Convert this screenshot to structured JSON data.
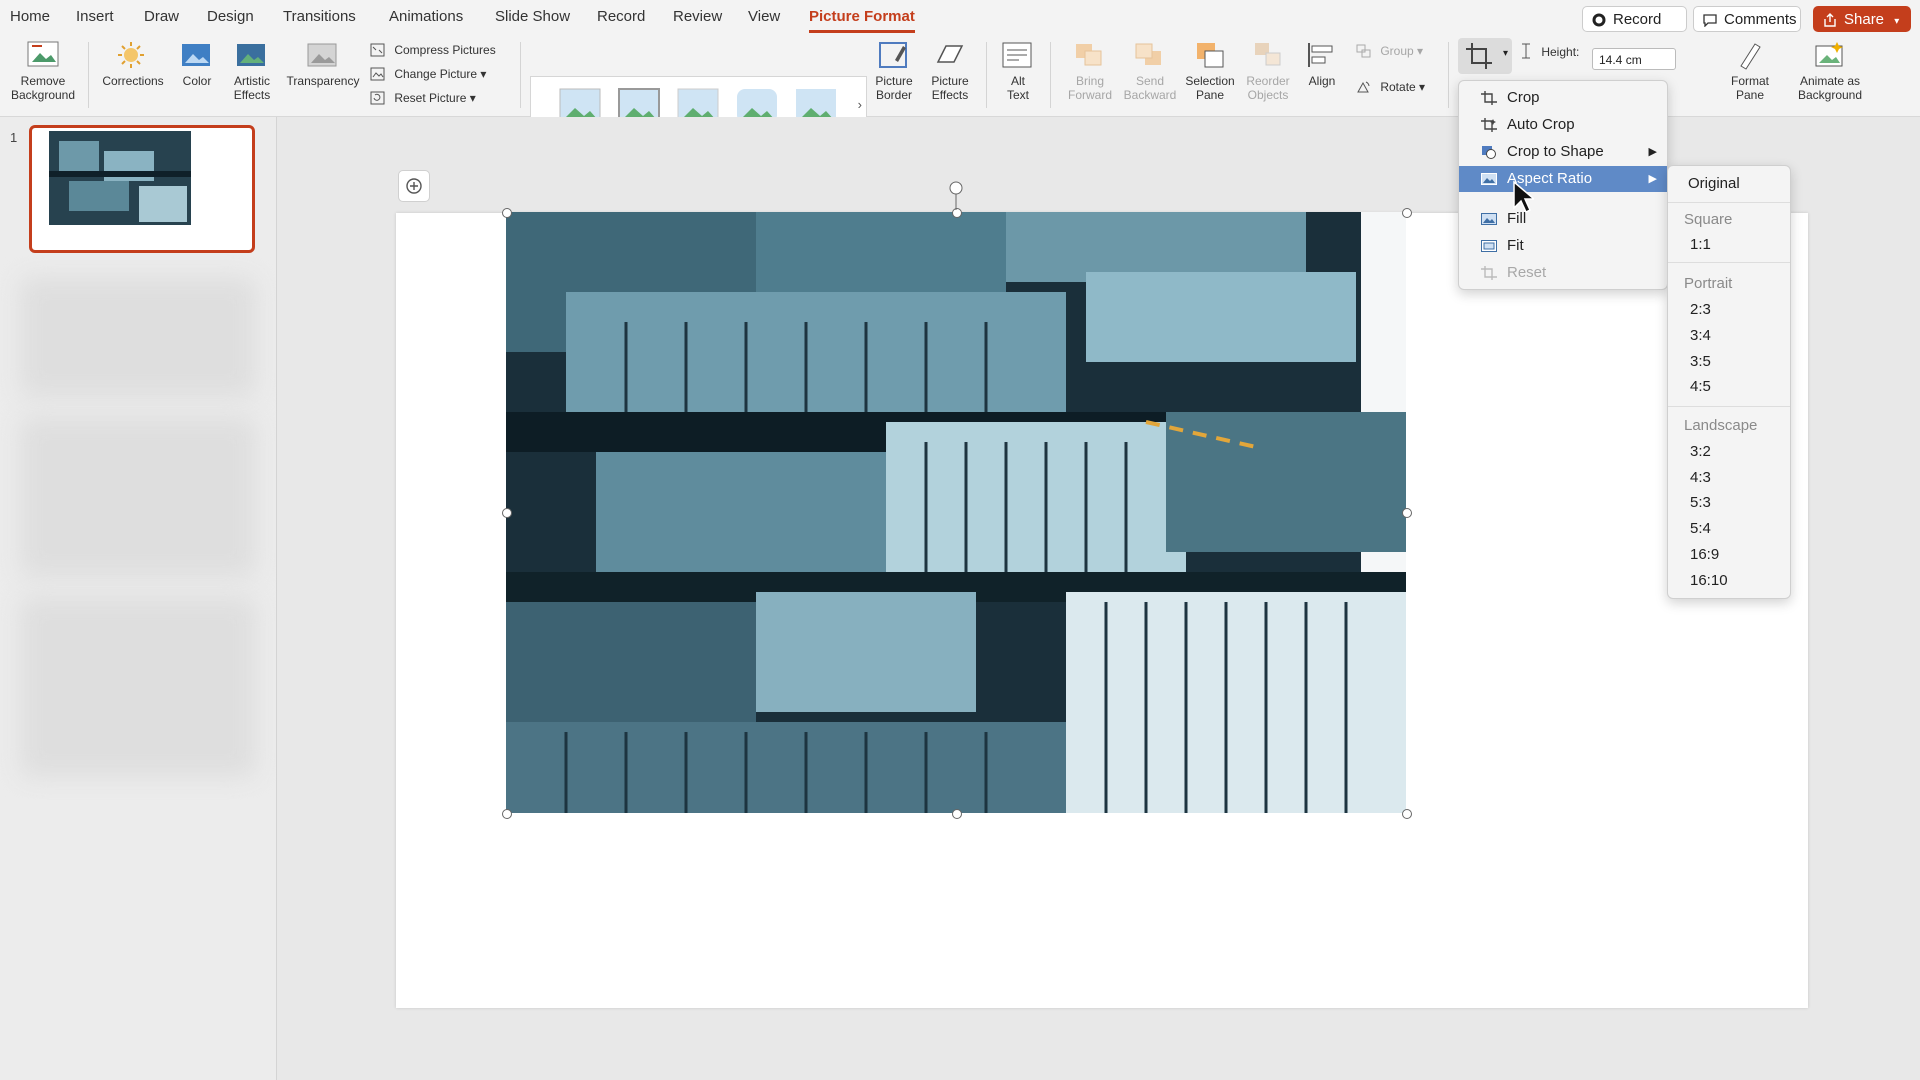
{
  "tabs": [
    "Home",
    "Insert",
    "Draw",
    "Design",
    "Transitions",
    "Animations",
    "Slide Show",
    "Record",
    "Review",
    "View",
    "Picture Format"
  ],
  "top_buttons": {
    "record": "Record",
    "comments": "Comments",
    "share": "Share"
  },
  "ribbon": {
    "remove_background": [
      "Remove",
      "Background"
    ],
    "corrections": "Corrections",
    "color": "Color",
    "artistic_effects": [
      "Artistic",
      "Effects"
    ],
    "transparency": "Transparency",
    "compress": "Compress Pictures",
    "change_picture": "Change Picture",
    "reset_picture": "Reset Picture",
    "picture_border": [
      "Picture",
      "Border"
    ],
    "picture_effects": [
      "Picture",
      "Effects"
    ],
    "alt_text": [
      "Alt",
      "Text"
    ],
    "bring_forward": [
      "Bring",
      "Forward"
    ],
    "send_backward": [
      "Send",
      "Backward"
    ],
    "selection_pane": [
      "Selection",
      "Pane"
    ],
    "reorder_objects": [
      "Reorder",
      "Objects"
    ],
    "align": "Align",
    "group": "Group",
    "rotate": "Rotate",
    "height_label": "Height:",
    "height_value": "14.4 cm",
    "format_pane": [
      "Format",
      "Pane"
    ],
    "animate_background": [
      "Animate as",
      "Background"
    ]
  },
  "thumbnail": {
    "slide_number": "1"
  },
  "crop_menu": {
    "items": [
      {
        "label": "Crop",
        "icon": "crop-icon"
      },
      {
        "label": "Auto Crop",
        "icon": "auto-crop-icon"
      },
      {
        "label": "Crop to Shape",
        "icon": "crop-to-shape-icon",
        "submenu": true
      },
      {
        "label": "Aspect Ratio",
        "icon": "aspect-ratio-icon",
        "submenu": true,
        "highlighted": true
      },
      {
        "label": "Fill",
        "icon": "fill-icon"
      },
      {
        "label": "Fit",
        "icon": "fit-icon"
      },
      {
        "label": "Reset",
        "icon": "reset-icon",
        "disabled": true
      }
    ]
  },
  "aspect_menu": {
    "original": "Original",
    "square_head": "Square",
    "square": [
      "1:1"
    ],
    "portrait_head": "Portrait",
    "portrait": [
      "2:3",
      "3:4",
      "3:5",
      "4:5"
    ],
    "landscape_head": "Landscape",
    "landscape": [
      "3:2",
      "4:3",
      "5:3",
      "5:4",
      "16:9",
      "16:10"
    ]
  },
  "colors": {
    "accent": "#c43e1c",
    "highlight": "#5f8ac7"
  }
}
